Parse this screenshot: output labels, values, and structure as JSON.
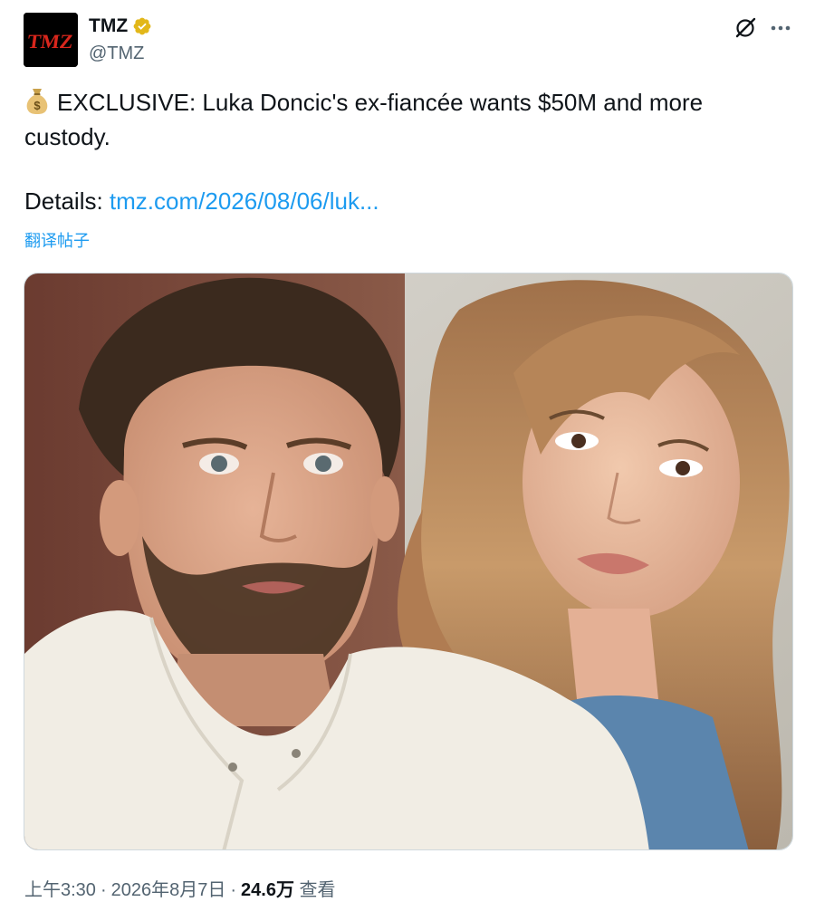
{
  "author": {
    "display_name": "TMZ",
    "handle": "@TMZ",
    "avatar_text": "TMZ",
    "verified_color": "#e2b719",
    "avatar_bg": "#000000",
    "avatar_brand_color": "#d8261c"
  },
  "actions": {
    "grok_icon": "grok-icon",
    "more_icon": "more-icon"
  },
  "tweet": {
    "emoji_icon": "money-bag-icon",
    "line1": "EXCLUSIVE: Luka Doncic's ex-fiancée wants $50M and more",
    "line2": "custody.",
    "details_prefix": "Details: ",
    "link_text": "tmz.com/2026/08/06/luk...",
    "translate": "翻译帖子"
  },
  "media": {
    "kind": "photo",
    "alt_description_icon": "photo-image"
  },
  "footer": {
    "time": "上午3:30",
    "date": "2026年8月7日",
    "views_count": "24.6万",
    "views_label": "查看",
    "separator": "·"
  },
  "colors": {
    "link": "#1d9bf0",
    "secondary_text": "#536471",
    "border": "#cfd9de"
  }
}
